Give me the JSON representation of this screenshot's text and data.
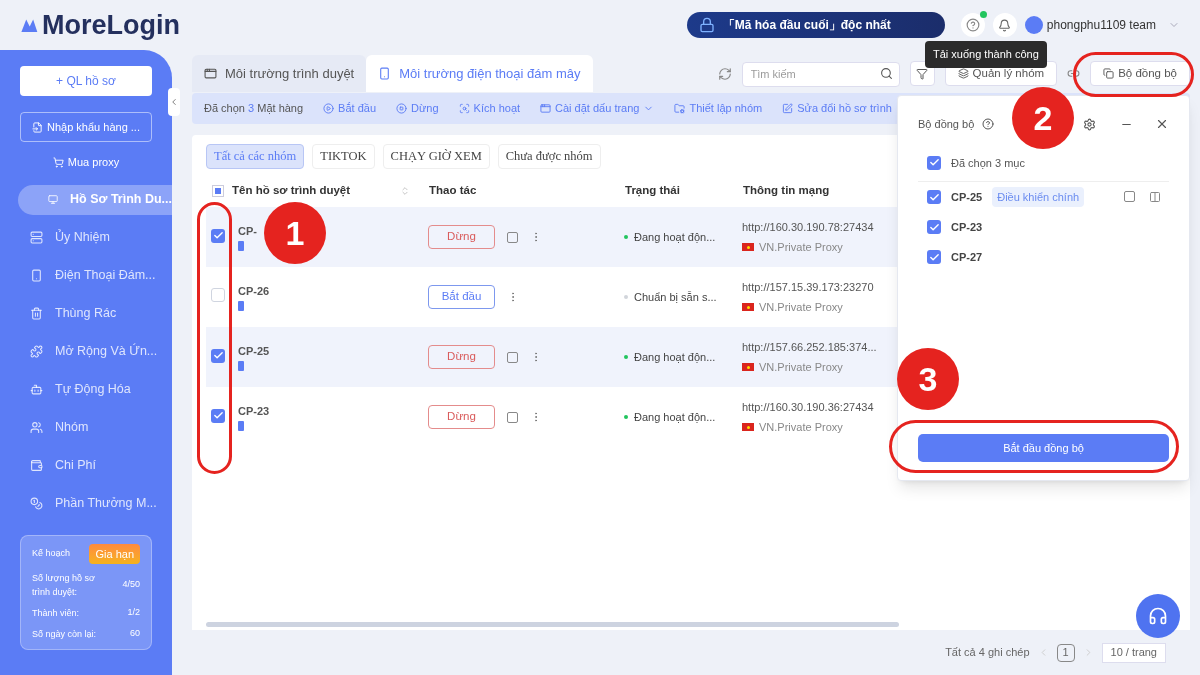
{
  "app": {
    "logo": "MoreLogin",
    "banner": "「Mã hóa đầu cuối」độc nhất",
    "user": "phongphu1109 team",
    "tooltip": "Tải xuống thành công"
  },
  "sidebar": {
    "new_button": "+ QL hồ sơ",
    "import_button": "Nhập khẩu hàng ...",
    "proxy_link": "Mua proxy",
    "items": [
      {
        "label": "Hồ Sơ Trình Du...",
        "selected": true
      },
      {
        "label": "Ủy Nhiệm",
        "selected": false
      },
      {
        "label": "Điện Thoại Đám...",
        "selected": false
      },
      {
        "label": "Thùng Rác",
        "selected": false
      },
      {
        "label": "Mở Rộng Và Ứn...",
        "selected": false
      },
      {
        "label": "Tự Động Hóa",
        "selected": false
      },
      {
        "label": "Nhóm",
        "selected": false
      },
      {
        "label": "Chi Phí",
        "selected": false
      },
      {
        "label": "Phần Thưởng M...",
        "selected": false
      }
    ],
    "plan": {
      "title": "Kế hoạch",
      "renew": "Gia hạn",
      "stats": [
        {
          "label": "Số lượng hồ sơ trình duyệt:",
          "value": "4/50"
        },
        {
          "label": "Thành viên:",
          "value": "1/2"
        },
        {
          "label": "Số ngày còn lại:",
          "value": "60"
        }
      ]
    }
  },
  "tabs": [
    {
      "label": "Môi trường trình duyệt",
      "selected": false
    },
    {
      "label": "Môi trường điện thoại đám mây",
      "selected": true
    }
  ],
  "toolbar": {
    "search_placeholder": "Tìm kiếm",
    "group_button": "Quản lý nhóm",
    "sync_button": "Bộ đồng bộ"
  },
  "action_bar": {
    "selected_prefix": "Đã chọn",
    "selected_count": "3",
    "selected_suffix": "Mặt hàng",
    "actions": [
      "Bắt đầu",
      "Dừng",
      "Kích hoạt",
      "Cài đặt dấu trang",
      "Thiết lập nhóm",
      "Sửa đổi hồ sơ trình"
    ]
  },
  "groups": [
    {
      "label": "Tất cả các nhóm",
      "selected": true
    },
    {
      "label": "TIKTOK",
      "selected": false
    },
    {
      "label": "CHẠY GIỜ XEM",
      "selected": false
    },
    {
      "label": "Chưa được nhóm",
      "selected": false
    }
  ],
  "table": {
    "select_all": {
      "indeterminate": true
    },
    "columns": [
      "Tên hồ sơ trình duyệt",
      "Thao tác",
      "Trạng thái",
      "Thông tin mạng"
    ],
    "rows": [
      {
        "name": "CP-",
        "checked": true,
        "action": {
          "label": "Dừng",
          "kind": "stop"
        },
        "status": "Đang hoạt độn...",
        "color": "#22c55e",
        "proxy": "http://160.30.190.78:27434",
        "proxy_type": "VN.Private Proxy"
      },
      {
        "name": "CP-26",
        "checked": false,
        "action": {
          "label": "Bắt đầu",
          "kind": "start"
        },
        "status": "Chuẩn bị sẵn s...",
        "color": "#d1d5db",
        "proxy": "http://157.15.39.173:23270",
        "proxy_type": "VN.Private Proxy"
      },
      {
        "name": "CP-25",
        "checked": true,
        "action": {
          "label": "Dừng",
          "kind": "stop"
        },
        "status": "Đang hoạt độn...",
        "color": "#22c55e",
        "proxy": "http://157.66.252.185:374...",
        "proxy_type": "VN.Private Proxy"
      },
      {
        "name": "CP-23",
        "checked": true,
        "action": {
          "label": "Dừng",
          "kind": "stop"
        },
        "status": "Đang hoạt độn...",
        "color": "#22c55e",
        "proxy": "http://160.30.190.36:27434",
        "proxy_type": "VN.Private Proxy"
      }
    ]
  },
  "pagination": {
    "total": "Tất cả 4 ghi chép",
    "page": "1",
    "page_size": "10 / trang"
  },
  "sync_panel": {
    "title": "Bộ đồng bộ",
    "select_all": {
      "label": "Đã chọn 3 mục",
      "checked": true
    },
    "items": [
      {
        "name": "CP-25",
        "checked": true,
        "tag": "Điều khiển chính"
      },
      {
        "name": "CP-23",
        "checked": true
      },
      {
        "name": "CP-27",
        "checked": true
      }
    ],
    "start_button": "Bắt đầu đồng bộ"
  },
  "annotations": [
    "1",
    "2",
    "3"
  ]
}
